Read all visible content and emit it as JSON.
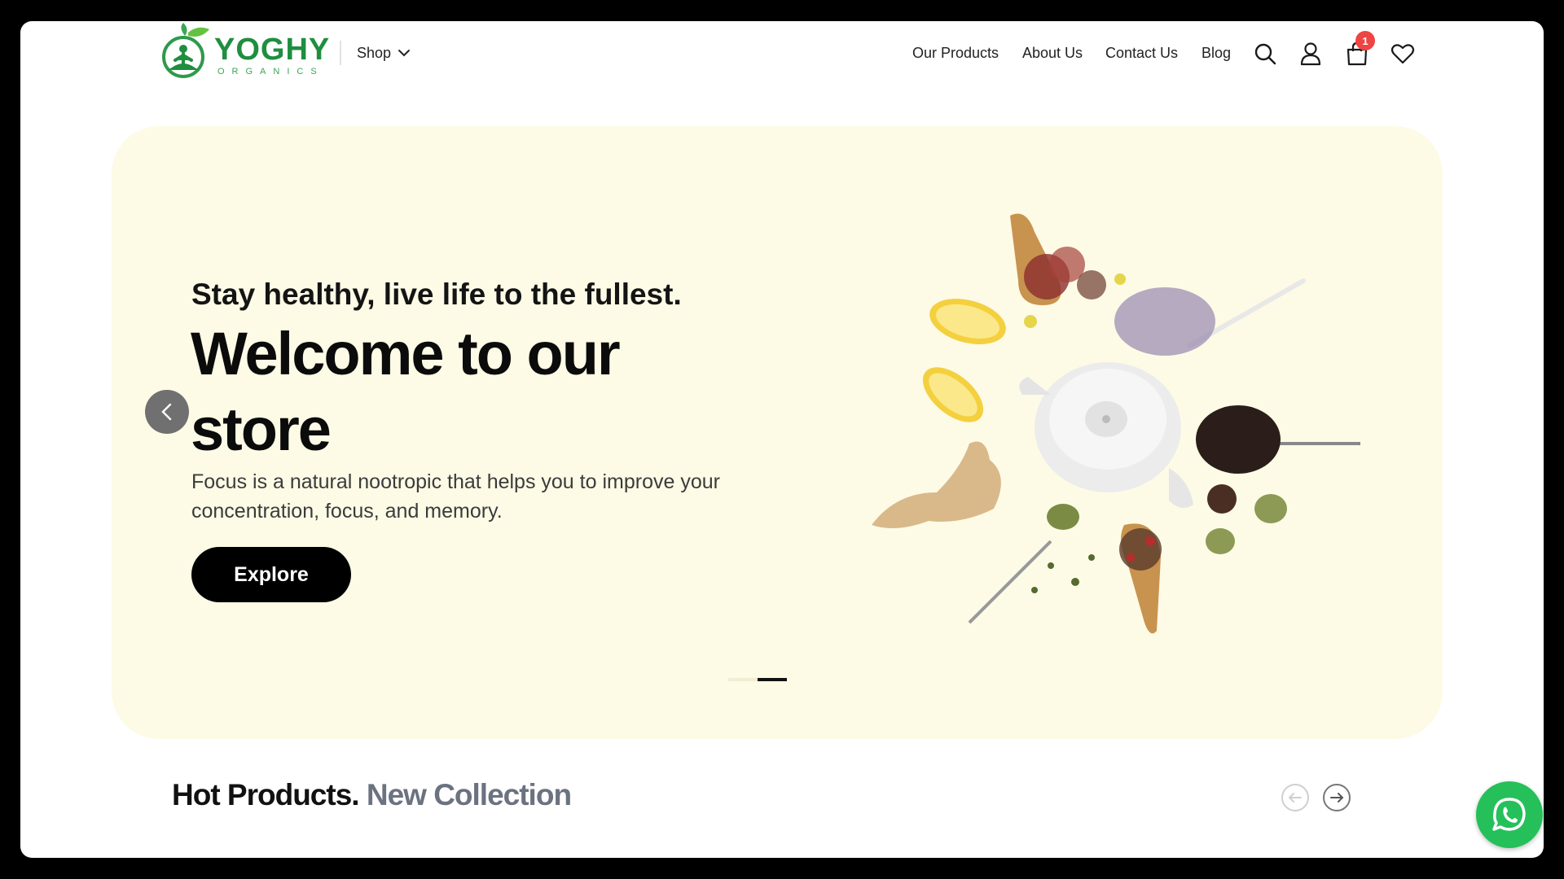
{
  "brand": {
    "name": "YOGHY",
    "subtitle": "ORGANICS",
    "logo_icon": "yoga-leaf-icon",
    "color": "#1f8e3f"
  },
  "header": {
    "shop_label": "Shop",
    "nav": [
      "Our Products",
      "About Us",
      "Contact Us",
      "Blog"
    ],
    "icons": [
      "search-icon",
      "user-icon",
      "cart-icon",
      "heart-icon"
    ],
    "cart_count": "1"
  },
  "hero": {
    "tagline": "Stay healthy, live life to the fullest.",
    "title": "Welcome to our store",
    "description": "Focus is a natural nootropic that helps you to improve your concentration, focus, and memory.",
    "cta_label": "Explore",
    "slide_count": 2,
    "active_slide": 2,
    "background": "#fdfbe6"
  },
  "section": {
    "title_bold": "Hot Products.",
    "title_muted": "New Collection"
  },
  "whatsapp": {
    "icon": "whatsapp-icon",
    "color": "#25c05a"
  }
}
